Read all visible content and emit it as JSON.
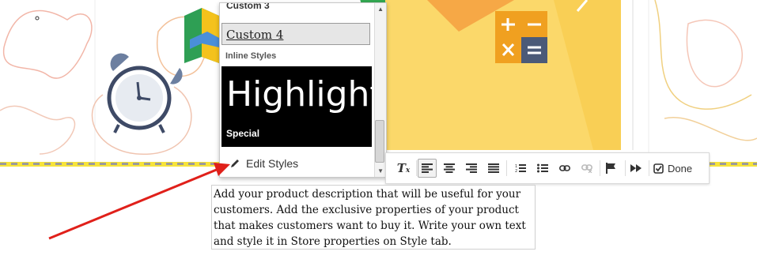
{
  "style_menu": {
    "partial_item": "Custom 3",
    "selected_item": "Custom 4",
    "group_label": "Inline Styles",
    "highlight_preview": "Highlight",
    "special_label": "Special",
    "edit_label": "Edit Styles"
  },
  "toolbar": {
    "remove_format_icon": "clear-formatting-icon",
    "buttons": [
      "align-left",
      "align-center",
      "align-right",
      "justify",
      "numbered-list",
      "bulleted-list",
      "link",
      "unlink",
      "anchor-flag",
      "more"
    ],
    "done_label": "Done"
  },
  "description": {
    "text": "Add your product description that will be useful for your customers. Add the exclusive properties of your product that makes customers want to buy it. Write your own text and style it in Store properties on Style tab."
  },
  "colors": {
    "accent_yellow": "#f6e33a",
    "tile_orange": "#f0a020",
    "tile_slate": "#4b5a78",
    "arrow_red": "#e0201a"
  }
}
